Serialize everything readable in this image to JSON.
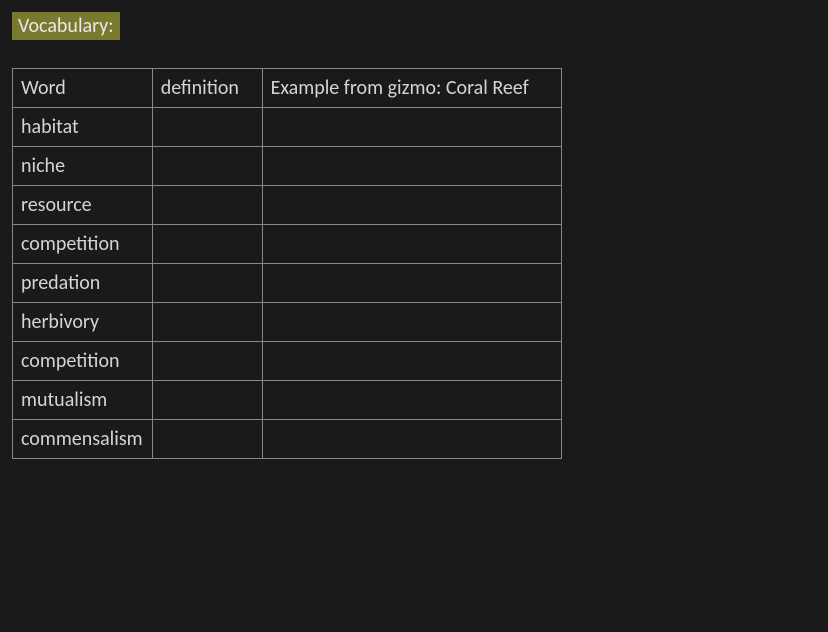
{
  "heading": "Vocabulary:",
  "table": {
    "headers": {
      "word": "Word",
      "definition": "definition",
      "example": "Example from gizmo: Coral Reef"
    },
    "rows": [
      {
        "word": "habitat",
        "definition": "",
        "example": ""
      },
      {
        "word": "niche",
        "definition": "",
        "example": ""
      },
      {
        "word": "resource",
        "definition": "",
        "example": ""
      },
      {
        "word": "competition",
        "definition": "",
        "example": ""
      },
      {
        "word": "predation",
        "definition": "",
        "example": ""
      },
      {
        "word": "herbivory",
        "definition": "",
        "example": ""
      },
      {
        "word": "competition",
        "definition": "",
        "example": ""
      },
      {
        "word": "mutualism",
        "definition": "",
        "example": ""
      },
      {
        "word": "commensalism",
        "definition": "",
        "example": ""
      }
    ]
  }
}
